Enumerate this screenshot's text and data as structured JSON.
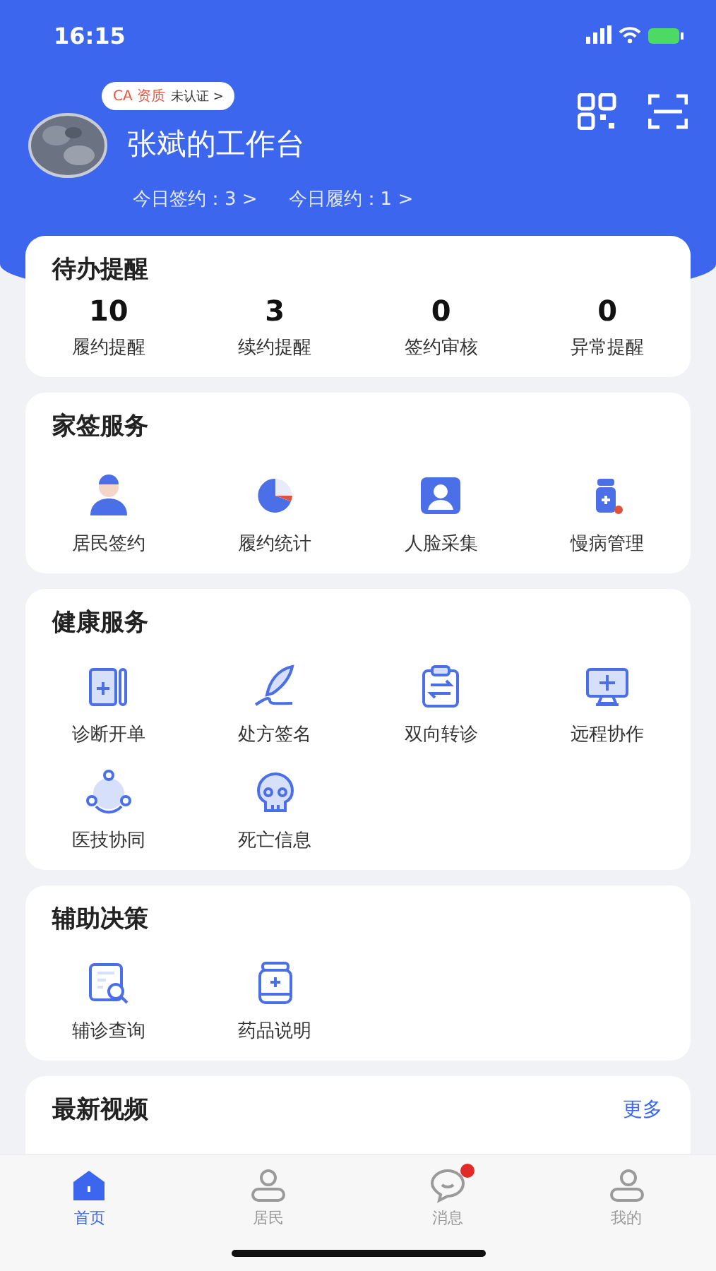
{
  "status_bar": {
    "time": "16:15"
  },
  "header": {
    "ca_label": "CA 资质",
    "ca_status": "未认证 >",
    "title": "张斌的工作台",
    "stats": [
      {
        "label": "今日签约：3 >"
      },
      {
        "label": "今日履约：1 >"
      }
    ]
  },
  "reminders": {
    "title": "待办提醒",
    "items": [
      {
        "count": "10",
        "label": "履约提醒"
      },
      {
        "count": "3",
        "label": "续约提醒"
      },
      {
        "count": "0",
        "label": "签约审核"
      },
      {
        "count": "0",
        "label": "异常提醒"
      }
    ]
  },
  "sections": [
    {
      "title": "家签服务",
      "items": [
        {
          "label": "居民签约"
        },
        {
          "label": "履约统计"
        },
        {
          "label": "人脸采集"
        },
        {
          "label": "慢病管理"
        }
      ]
    },
    {
      "title": "健康服务",
      "items": [
        {
          "label": "诊断开单"
        },
        {
          "label": "处方签名"
        },
        {
          "label": "双向转诊"
        },
        {
          "label": "远程协作"
        },
        {
          "label": "医技协同"
        },
        {
          "label": "死亡信息"
        }
      ]
    },
    {
      "title": "辅助决策",
      "items": [
        {
          "label": "辅诊查询"
        },
        {
          "label": "药品说明"
        }
      ]
    }
  ],
  "videos": {
    "title": "最新视频",
    "more": "更多"
  },
  "tab_bar": [
    {
      "label": "首页",
      "selected": true,
      "unread": false
    },
    {
      "label": "居民",
      "selected": false,
      "unread": false
    },
    {
      "label": "消息",
      "selected": false,
      "unread": true
    },
    {
      "label": "我的",
      "selected": false,
      "unread": false
    }
  ]
}
